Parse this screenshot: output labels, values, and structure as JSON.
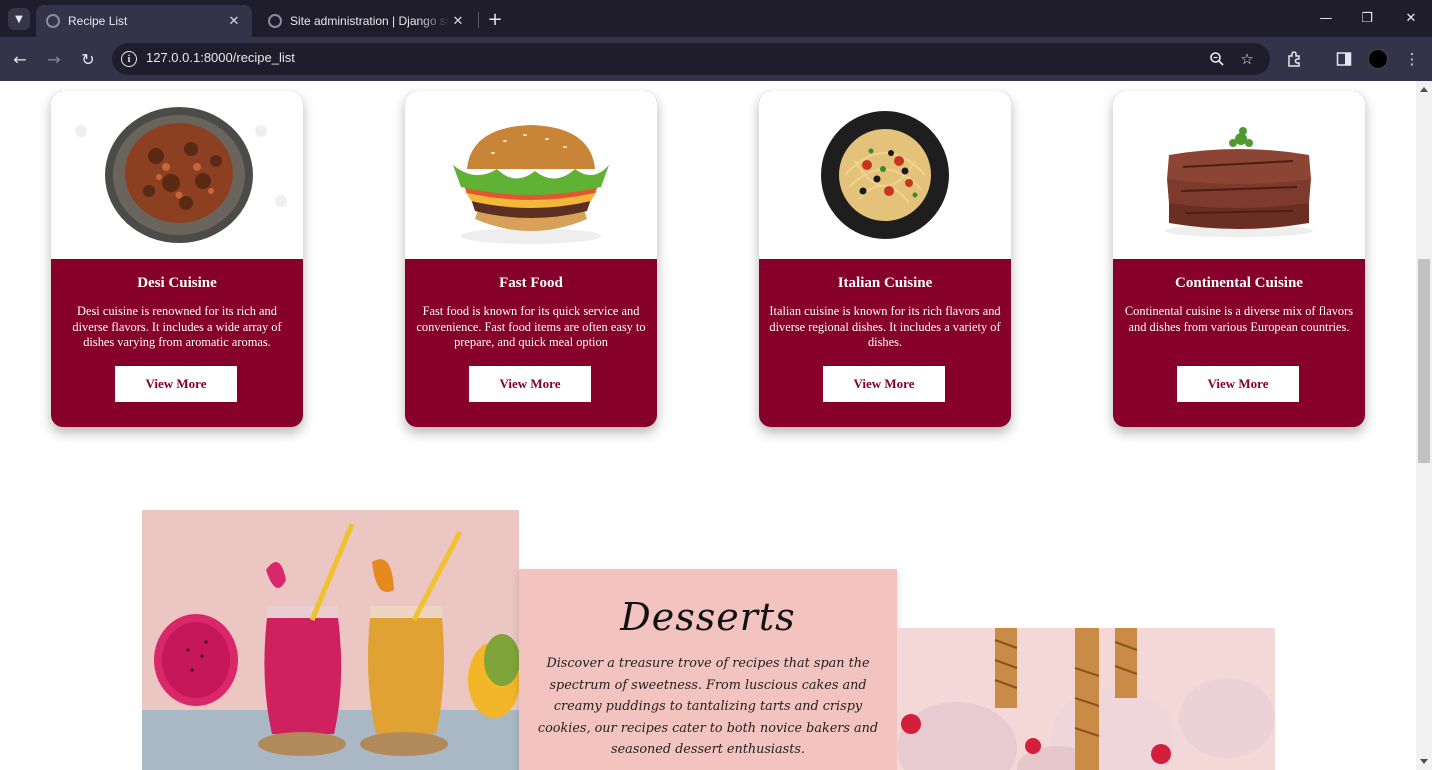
{
  "browser": {
    "tabs": [
      {
        "title": "Recipe List",
        "active": true
      },
      {
        "title": "Site administration | Django site admin",
        "active": false
      }
    ],
    "url": "127.0.0.1:8000/recipe_list"
  },
  "cuisines": [
    {
      "title": "Desi Cuisine",
      "description": "Desi cuisine is renowned for its rich and diverse flavors. It includes a wide array of dishes varying from aromatic aromas.",
      "button": "View More",
      "image": "bowl-of-curry"
    },
    {
      "title": "Fast Food",
      "description": "Fast food is known for its quick service and convenience. Fast food items are often easy to prepare, and quick meal option",
      "button": "View More",
      "image": "burger"
    },
    {
      "title": "Italian Cuisine",
      "description": "Italian cuisine is known for its rich flavors and diverse regional dishes. It includes a variety of dishes.",
      "button": "View More",
      "image": "spaghetti-plate"
    },
    {
      "title": "Continental Cuisine",
      "description": "Continental cuisine is a diverse mix of flavors and dishes from various European countries.",
      "button": "View More",
      "image": "steak-stack"
    }
  ],
  "desserts": {
    "title": "Desserts",
    "description": "Discover a treasure trove of recipes that span the spectrum of sweetness. From luscious cakes and creamy puddings to tantalizing tarts and crispy cookies, our recipes cater to both novice bakers and seasoned dessert enthusiasts.",
    "images": [
      "smoothie-jars",
      "ice-cream-scoops"
    ]
  },
  "colors": {
    "card_body": "#87002b",
    "dessert_card": "#f3c3bf",
    "browser_tabbar": "#1f1d2b",
    "browser_toolbar": "#35334a"
  }
}
